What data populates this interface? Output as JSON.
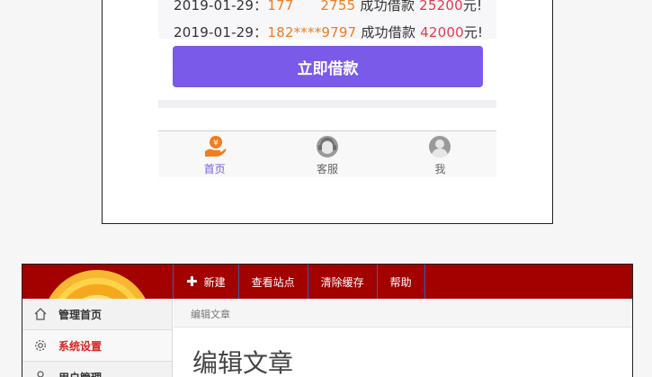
{
  "ticker": [
    {
      "date": "2019-01-29：",
      "phone": "177",
      "mid": "2755",
      "action": "成功借款",
      "amount": "25200",
      "unit": "元!"
    },
    {
      "date": "2019-01-29：",
      "phone": "182****9797",
      "action": "成功借款",
      "amount": "42000",
      "unit": "元!"
    }
  ],
  "loan_button": "立即借款",
  "tabbar": [
    {
      "label": "首页",
      "icon": "home-money-icon",
      "active": true
    },
    {
      "label": "客服",
      "icon": "customer-service-icon",
      "active": false
    },
    {
      "label": "我",
      "icon": "user-avatar-icon",
      "active": false
    }
  ],
  "admin": {
    "nav": [
      "新建",
      "查看站点",
      "清除缓存",
      "帮助"
    ],
    "sidebar": [
      {
        "label": "管理首页",
        "icon": "home-icon"
      },
      {
        "label": "系统设置",
        "icon": "gear-icon"
      },
      {
        "label": "用户管理",
        "icon": "user-icon"
      }
    ],
    "breadcrumb": "编辑文章",
    "page_title": "编辑文章"
  },
  "colors": {
    "accent_purple": "#7a5ae8",
    "ticker_orange": "#f07c1f",
    "ticker_red": "#e8384a",
    "admin_red": "#a30000",
    "active_side": "#dd2222"
  }
}
